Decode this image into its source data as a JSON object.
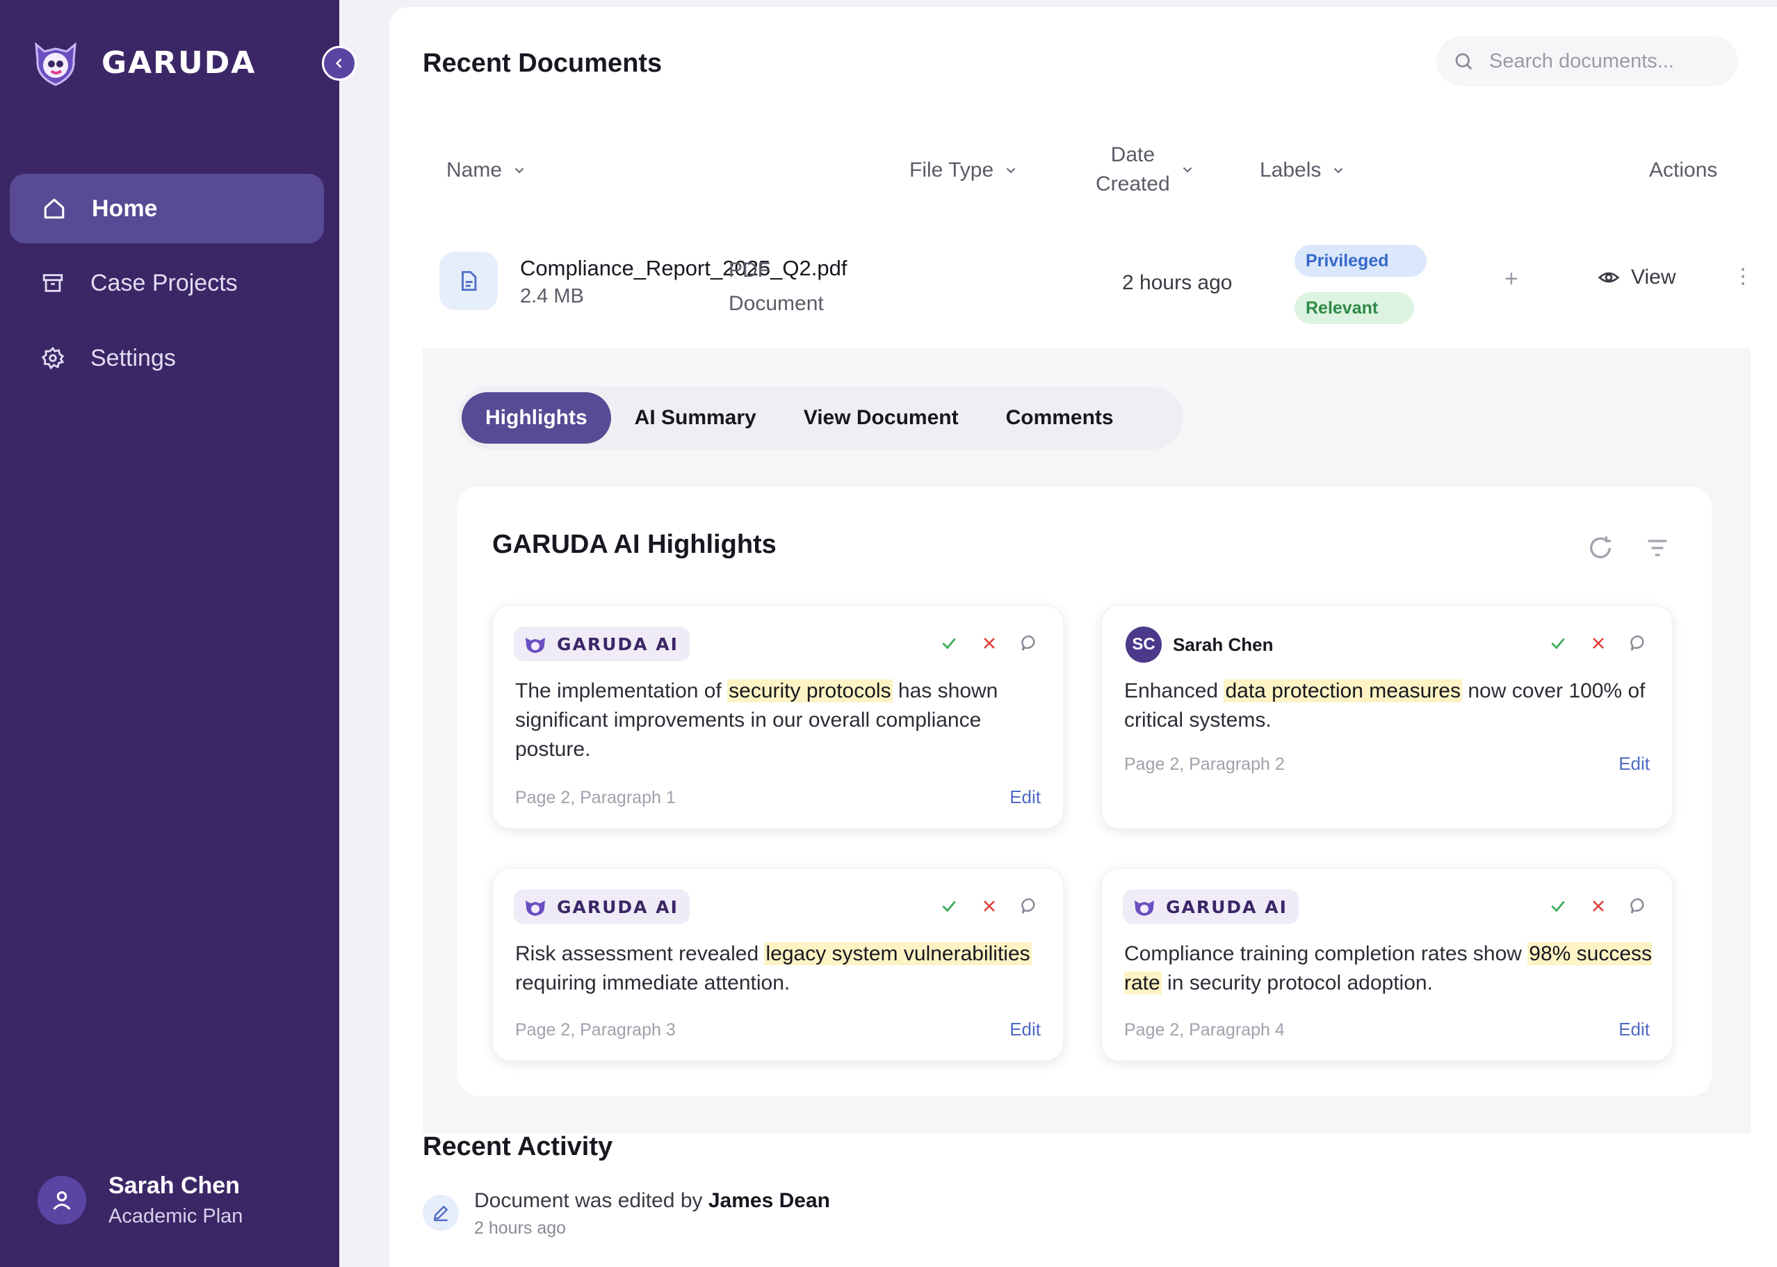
{
  "brand": {
    "name": "GARUDA"
  },
  "sidebar": {
    "items": [
      {
        "label": "Home",
        "icon": "home-icon",
        "active": true
      },
      {
        "label": "Case Projects",
        "icon": "archive-icon",
        "active": false
      },
      {
        "label": "Settings",
        "icon": "gear-icon",
        "active": false
      }
    ],
    "user": {
      "name": "Sarah Chen",
      "plan": "Academic Plan"
    }
  },
  "header": {
    "title": "Recent Documents",
    "search_placeholder": "Search documents..."
  },
  "table": {
    "columns": {
      "name": "Name",
      "file_type": "File Type",
      "date_line1": "Date",
      "date_line2": "Created",
      "labels": "Labels",
      "actions": "Actions"
    },
    "row": {
      "file_name": "Compliance_Report_2025_Q2.pdf",
      "file_size": "2.4 MB",
      "file_type_line1": "PDF",
      "file_type_line2": "Document",
      "date_created": "2 hours ago",
      "labels": [
        "Privileged",
        "Relevant"
      ],
      "add_label": "+",
      "view_label": "View",
      "more": "⋮"
    }
  },
  "tabs": [
    "Highlights",
    "AI Summary",
    "View Document",
    "Comments"
  ],
  "active_tab": "Highlights",
  "highlights": {
    "title": "GARUDA AI Highlights",
    "ai_badge": "GARUDA AI",
    "edit_label": "Edit",
    "cards": [
      {
        "author": "GARUDA AI",
        "text_before": "The implementation of ",
        "highlight": "security protocols",
        "text_after": " has shown significant improvements in our overall compliance posture.",
        "meta": "Page 2, Paragraph 1"
      },
      {
        "author": "Sarah Chen",
        "author_initials": "SC",
        "text_before": "Enhanced ",
        "highlight": "data protection measures",
        "text_after": " now cover 100% of critical systems.",
        "meta": "Page 2, Paragraph 2"
      },
      {
        "author": "GARUDA AI",
        "text_before": "Risk assessment revealed ",
        "highlight": "legacy system vulnerabilities",
        "text_after": " requiring immediate attention.",
        "meta": "Page 2, Paragraph 3"
      },
      {
        "author": "GARUDA AI",
        "text_before": "Compliance training completion rates show ",
        "highlight": "98% success rate",
        "text_after": " in security protocol adoption.",
        "meta": "Page 2, Paragraph 4"
      }
    ]
  },
  "activity": {
    "title": "Recent Activity",
    "items": [
      {
        "text": "Document was edited by ",
        "actor": "James Dean",
        "time": "2 hours ago",
        "icon": "pencil-icon"
      }
    ]
  },
  "colors": {
    "sidebar_bg": "#3b2766",
    "accent": "#584a94",
    "highlight": "#fdf3c4",
    "approve": "#3fae5a",
    "reject": "#e0403a",
    "link": "#4f6bc4"
  }
}
